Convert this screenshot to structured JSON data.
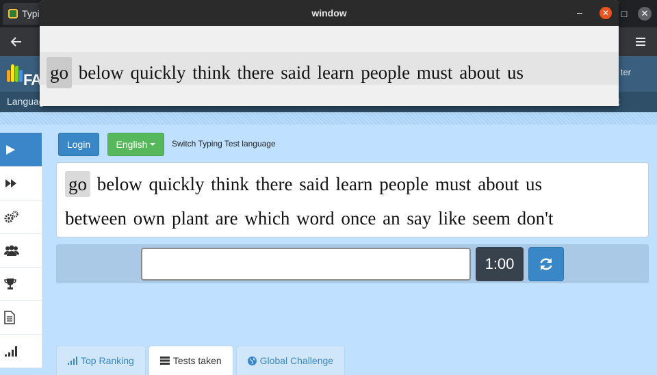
{
  "browser": {
    "tab_title": "Typi",
    "max_glyph": "□",
    "close_glyph": "✕"
  },
  "site": {
    "logo_text": "FAS",
    "header_right": "ter",
    "nav_label": "Languag",
    "nav_right": "t"
  },
  "sidebar": {
    "items": [
      {
        "icon": "play-icon",
        "glyph": "▶",
        "active": true
      },
      {
        "icon": "fast-forward-icon",
        "glyph": "⏩"
      },
      {
        "icon": "gears-icon",
        "glyph": "⚙"
      },
      {
        "icon": "users-icon",
        "glyph": "👥"
      },
      {
        "icon": "trophy-icon",
        "glyph": "🏆"
      },
      {
        "icon": "document-icon",
        "glyph": "📄"
      },
      {
        "icon": "signal-bars-icon",
        "glyph": "📶"
      }
    ]
  },
  "controls": {
    "login_label": "Login",
    "language_label": "English",
    "language_hint": "Switch Typing Test language"
  },
  "words": {
    "line1": [
      "go",
      "below",
      "quickly",
      "think",
      "there",
      "said",
      "learn",
      "people",
      "must",
      "about",
      "us"
    ],
    "line2": [
      "between",
      "own",
      "plant",
      "are",
      "which",
      "word",
      "once",
      "an",
      "say",
      "like",
      "seem",
      "don't"
    ],
    "current_index": 0
  },
  "typing": {
    "input_value": "",
    "timer": "1:00"
  },
  "tabs": [
    {
      "label": "Top Ranking",
      "icon": "bar-chart-icon",
      "active": false
    },
    {
      "label": "Tests taken",
      "icon": "list-icon",
      "active": true
    },
    {
      "label": "Global Challenge",
      "icon": "globe-icon",
      "active": false
    }
  ],
  "popup": {
    "title": "window",
    "min_glyph": "–",
    "close_glyph": "✕"
  },
  "colors": {
    "accent_blue": "#3a87c8",
    "success_green": "#56b85a",
    "timer_dark": "#37424c",
    "page_bg": "#bfe0ff",
    "ubuntu_close": "#e95420"
  }
}
